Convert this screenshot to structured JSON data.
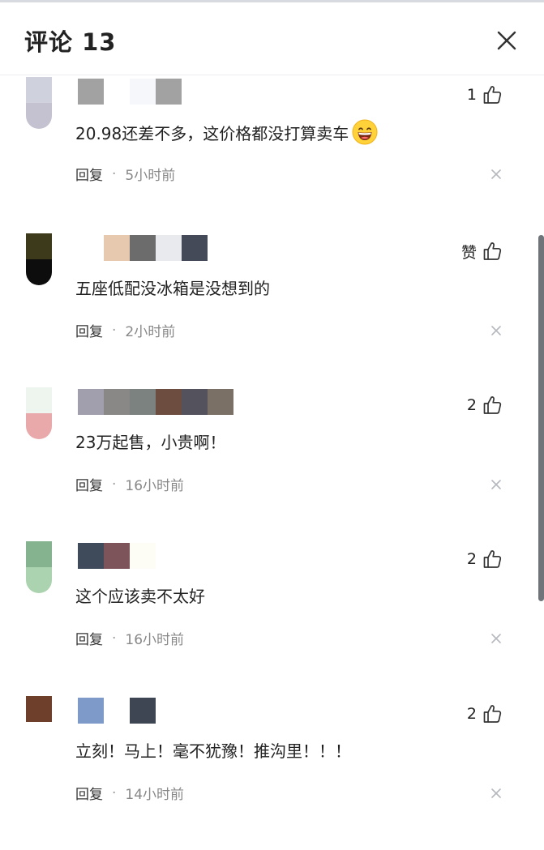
{
  "header": {
    "title": "评论 13"
  },
  "labels": {
    "reply": "回复",
    "separator": "·"
  },
  "comments": [
    {
      "like_label": "1",
      "text": "20.98还差不多，这价格都没打算卖车",
      "emoji": "grinning-face-emoji",
      "time": "5小时前",
      "avatar_colors": [
        "#cfd2dc",
        "#c4c2d0"
      ],
      "name_blocks": [
        "#a2a2a2",
        "#ffffff",
        "#f6f7fa",
        "#a2a2a2"
      ]
    },
    {
      "like_label": "赞",
      "text": "五座低配没冰箱是没想到的",
      "time": "2小时前",
      "avatar_colors": [
        "#3d3a1c",
        "#0d0d0d"
      ],
      "name_blocks": [
        "#ffffff",
        "#e6c9ae",
        "#6c6c6c",
        "#e9eaed",
        "#444a57"
      ]
    },
    {
      "like_label": "2",
      "text": "23万起售，小贵啊！",
      "time": "16小时前",
      "avatar_colors": [
        "#eef4ee",
        "#e9a9aa"
      ],
      "name_blocks": [
        "#a19eae",
        "#898887",
        "#7c827f",
        "#6d4d40",
        "#54525c",
        "#7a7065"
      ]
    },
    {
      "like_label": "2",
      "text": "这个应该卖不太好",
      "time": "16小时前",
      "avatar_colors": [
        "#85b38f",
        "#abd3af"
      ],
      "name_blocks": [
        "#3f4b5a",
        "#7e545b",
        "#fdfdf6"
      ]
    },
    {
      "like_label": "2",
      "text": "立刻！马上！毫不犹豫！推沟里！！！",
      "time": "14小时前",
      "avatar_colors": [
        "#6e3f2a",
        "#ffffff"
      ],
      "name_blocks": [
        "#7d9ac8",
        "#ffffff",
        "#3e4654"
      ]
    }
  ]
}
